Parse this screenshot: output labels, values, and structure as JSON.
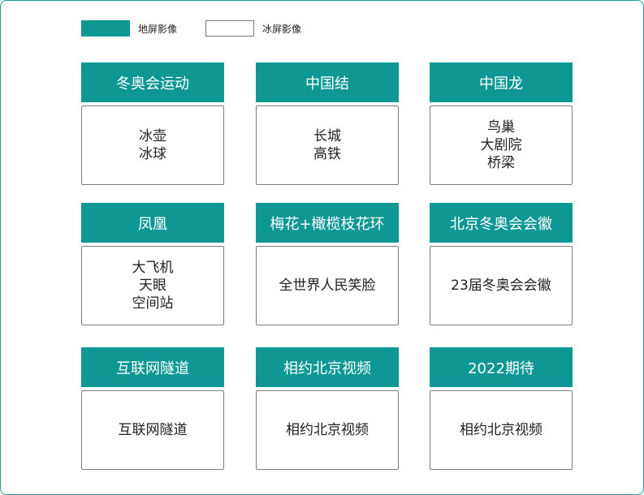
{
  "legend": [
    {
      "label": "地屏影像",
      "style": "filled",
      "color": "#0f9893"
    },
    {
      "label": "冰屏影像",
      "style": "outline",
      "color": "#ffffff"
    }
  ],
  "nodes": [
    {
      "title": "冬奥会运动",
      "items": [
        "冰壶",
        "冰球"
      ]
    },
    {
      "title": "中国结",
      "items": [
        "长城",
        "高铁"
      ]
    },
    {
      "title": "中国龙",
      "items": [
        "鸟巢",
        "大剧院",
        "桥梁"
      ]
    },
    {
      "title": "凤凰",
      "items": [
        "大飞机",
        "天眼",
        "空间站"
      ]
    },
    {
      "title": "梅花+橄榄枝花环",
      "items": [
        "全世界人民笑脸"
      ]
    },
    {
      "title": "北京冬奥会会徽",
      "items": [
        "23届冬奥会会徽"
      ]
    },
    {
      "title": "互联网隧道",
      "items": [
        "互联网隧道"
      ]
    },
    {
      "title": "相约北京视频",
      "items": [
        "相约北京视频"
      ]
    },
    {
      "title": "2022期待",
      "items": [
        "相约北京视频"
      ]
    }
  ],
  "colors": {
    "accent": "#0f9893",
    "border": "#7d7d7d",
    "frame": "#1f9a95"
  }
}
